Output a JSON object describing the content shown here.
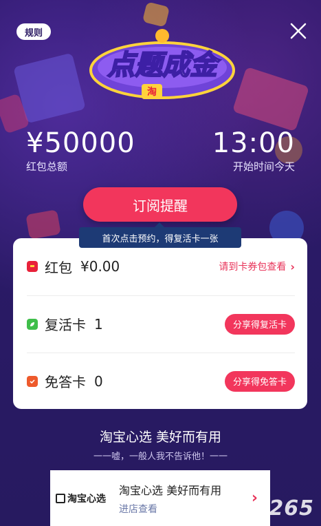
{
  "header": {
    "rules_label": "规则",
    "logo_text": "点题成金",
    "logo_badge": "淘"
  },
  "stats": {
    "total_amount": "¥50000",
    "total_label": "红包总额",
    "start_time": "13:00",
    "start_label": "开始时间今天"
  },
  "subscribe": {
    "label": "订阅提醒",
    "tooltip": "首次点击预约，得复活卡一张"
  },
  "card": {
    "rows": [
      {
        "label": "红包",
        "value": "¥0.00",
        "action": "请到卡券包查看",
        "action_chevron": "›"
      },
      {
        "label": "复活卡",
        "value": "1",
        "action": "分享得复活卡"
      },
      {
        "label": "免答卡",
        "value": "0",
        "action": "分享得免答卡"
      }
    ]
  },
  "footer": {
    "slogan": "淘宝心选 美好而有用",
    "sub_slogan": "一一嘘，一般人我不告诉他！一一"
  },
  "shop_banner": {
    "logo_text": "淘宝心选",
    "title": "淘宝心选 美好而有用",
    "subtitle": "进店查看",
    "arrow": "›"
  },
  "watermark": "2265",
  "colors": {
    "background": "#2b1a63",
    "accent_red": "#f2365c",
    "tooltip_blue": "#1d3a75",
    "icon_red": "#e8223a",
    "icon_green": "#3fbe4a",
    "icon_orange": "#ee5a2c"
  }
}
